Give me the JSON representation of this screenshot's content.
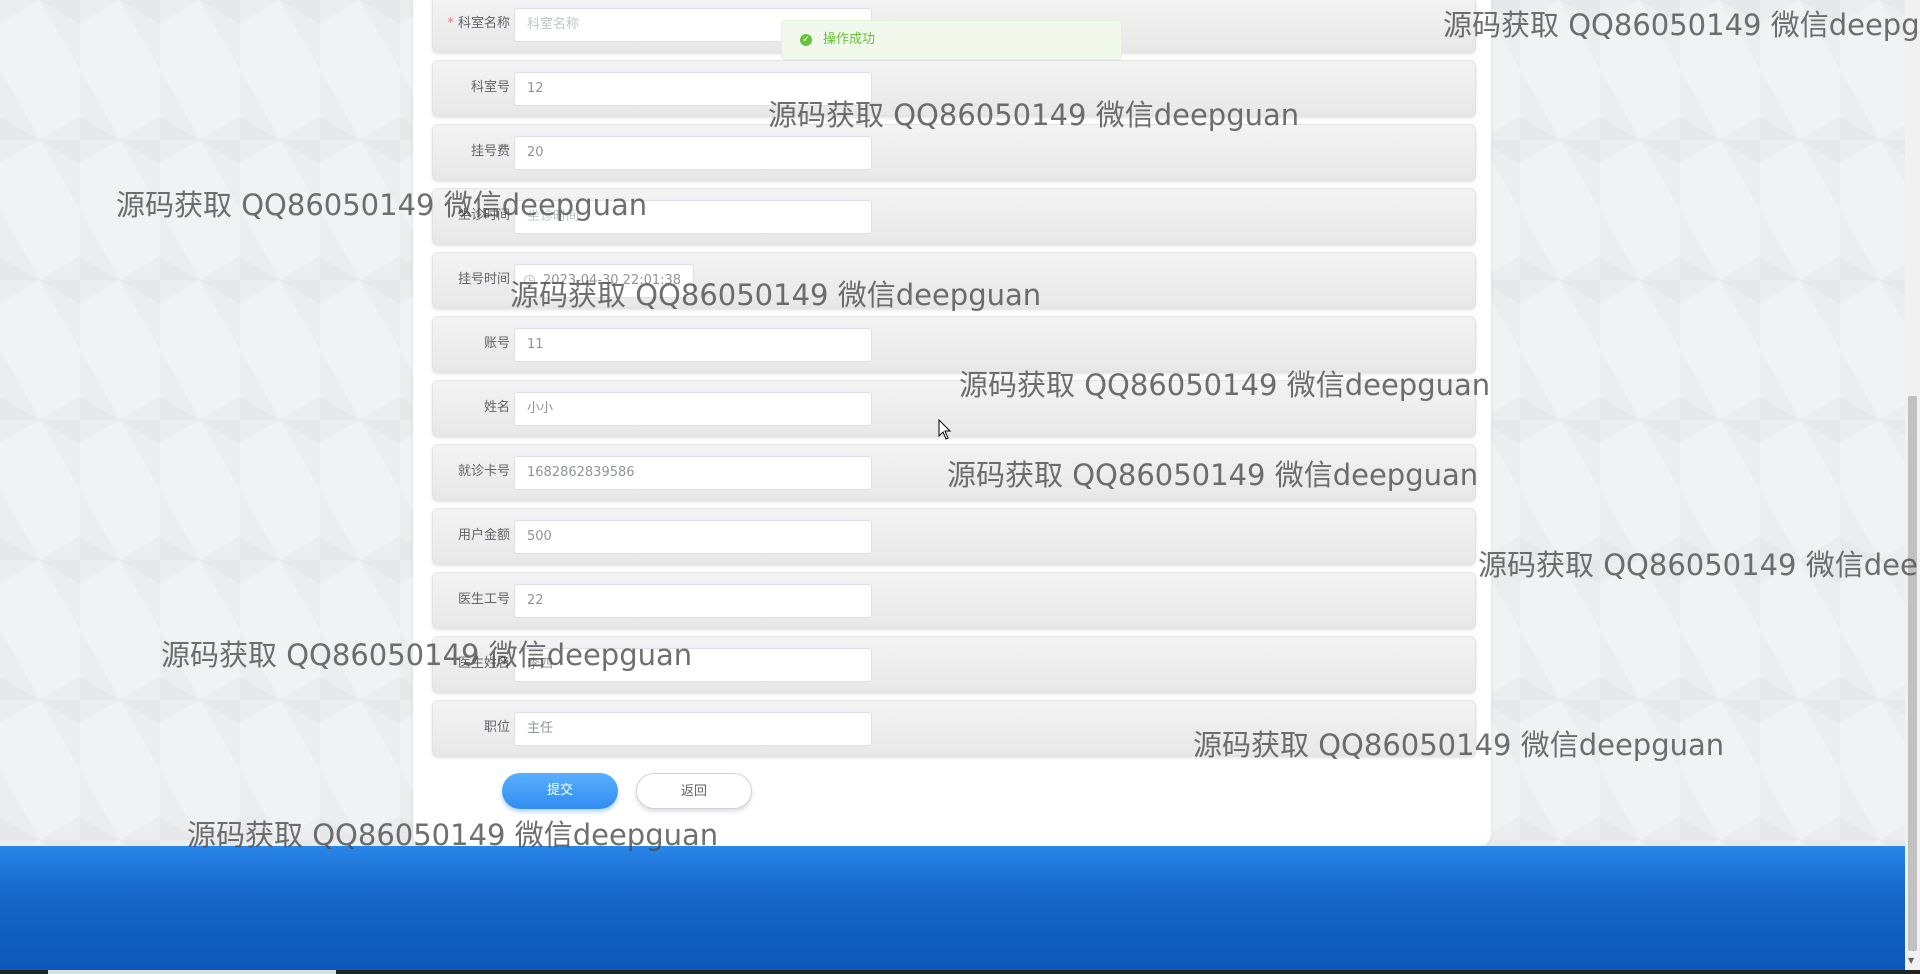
{
  "form": {
    "rows": [
      {
        "label": "科室名称",
        "value": "科室名称",
        "required": true,
        "placeholder": true
      },
      {
        "label": "科室号",
        "value": "12"
      },
      {
        "label": "挂号费",
        "value": "20"
      },
      {
        "label": "坐诊时间",
        "value": "坐诊时间",
        "placeholder": true
      },
      {
        "label": "挂号时间",
        "value": "2023-04-30 22:01:38",
        "icon": "clock-icon"
      },
      {
        "label": "账号",
        "value": "11"
      },
      {
        "label": "姓名",
        "value": "小小"
      },
      {
        "label": "就诊卡号",
        "value": "1682862839586"
      },
      {
        "label": "用户金额",
        "value": "500"
      },
      {
        "label": "医生工号",
        "value": "22"
      },
      {
        "label": "医生姓名",
        "value": "李四"
      },
      {
        "label": "职位",
        "value": "主任"
      }
    ],
    "submit_label": "提交",
    "back_label": "返回"
  },
  "toast": {
    "message": "操作成功",
    "icon": "check-circle-icon",
    "color": "#67c23a"
  },
  "colors": {
    "primary": "#2f8cf0",
    "footer": "#1566c8",
    "required": "#f56c6c"
  },
  "watermark": {
    "text": "源码获取 QQ86050149 微信deepguan"
  }
}
